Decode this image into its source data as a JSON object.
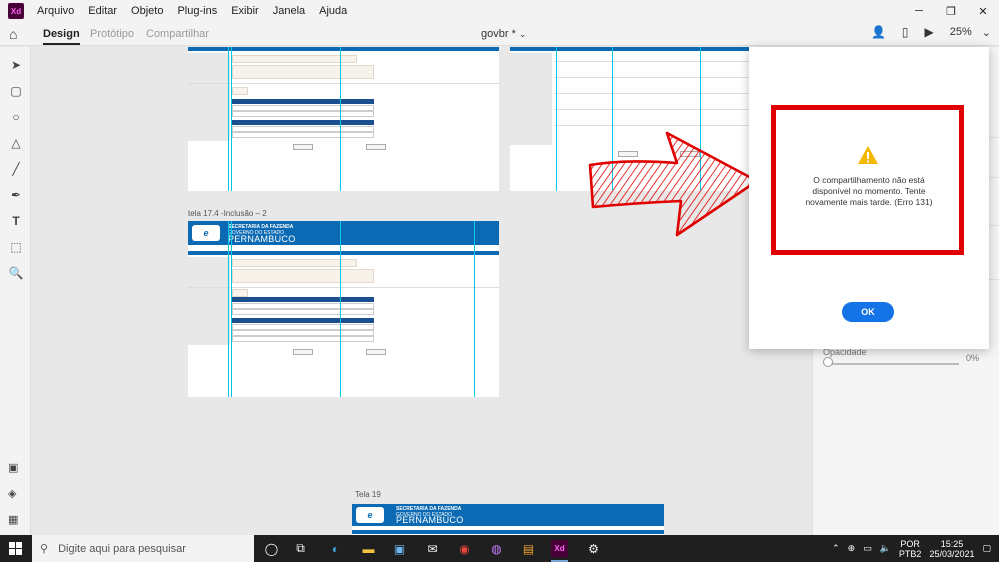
{
  "app": {
    "logo_text": "Xd",
    "menu": [
      "Arquivo",
      "Editar",
      "Objeto",
      "Plug-ins",
      "Exibir",
      "Janela",
      "Ajuda"
    ],
    "window_controls": [
      "─",
      "❐",
      "✕"
    ]
  },
  "modebar": {
    "tabs": [
      {
        "label": "Design",
        "active": true
      },
      {
        "label": "Protótipo",
        "active": false
      },
      {
        "label": "Compartilhar",
        "active": false
      }
    ],
    "doc_title": "govbr *",
    "zoom": "25%"
  },
  "canvas": {
    "artboards": [
      {
        "label": "tela 17.4 -Inclusão – 2"
      },
      {
        "label": "Tela 19"
      }
    ],
    "gov": {
      "org": "SECRETARIA DA FAZENDA",
      "gov_line": "GOVERNO DO ESTADO",
      "state": "PERNAMBUCO",
      "logo": "e"
    }
  },
  "properties": {
    "opacity_label": "Opacidade",
    "opacity_value": "0%"
  },
  "dialog": {
    "message": "O compartilhamento não está disponível no momento. Tente novamente mais tarde. (Erro 131)",
    "ok_label": "OK",
    "warning_color": "#f5b800",
    "highlight_color": "#e00000"
  },
  "taskbar": {
    "search_placeholder": "Digite aqui para pesquisar",
    "lang_line1": "POR",
    "lang_line2": "PTB2",
    "time": "15:25",
    "date": "25/03/2021"
  }
}
